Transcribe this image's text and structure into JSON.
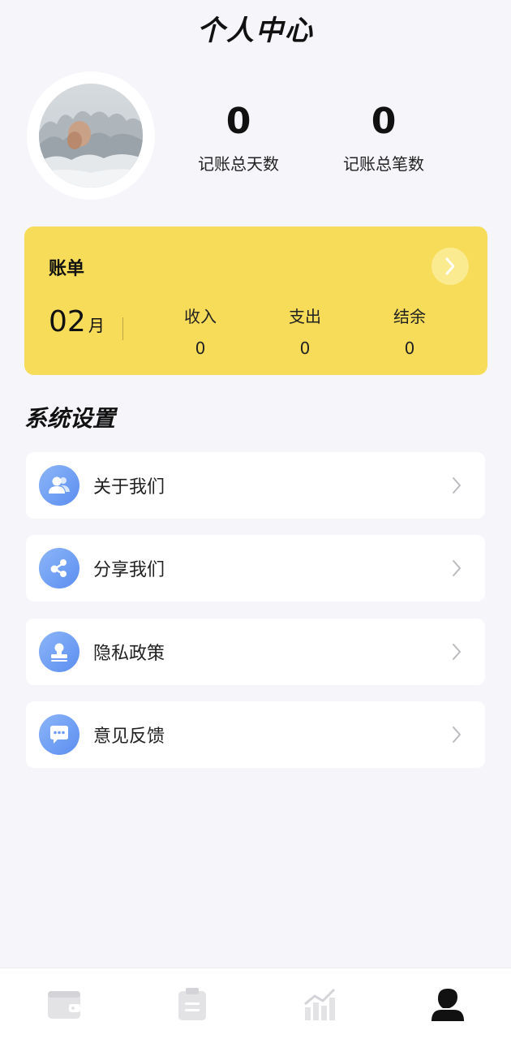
{
  "header": {
    "title": "个人中心"
  },
  "stats": {
    "days_value": "0",
    "days_label": "记账总天数",
    "count_value": "0",
    "count_label": "记账总笔数"
  },
  "bill": {
    "title": "账单",
    "arrow_icon": "chevron-right-icon",
    "month": "02",
    "month_unit": "月",
    "income_label": "收入",
    "income_value": "0",
    "expense_label": "支出",
    "expense_value": "0",
    "balance_label": "结余",
    "balance_value": "0"
  },
  "settings": {
    "title": "系统设置",
    "items": [
      {
        "label": "关于我们",
        "icon": "users-icon"
      },
      {
        "label": "分享我们",
        "icon": "share-icon"
      },
      {
        "label": "隐私政策",
        "icon": "stamp-icon"
      },
      {
        "label": "意见反馈",
        "icon": "chat-icon"
      }
    ]
  },
  "tabbar": {
    "tabs": [
      {
        "name": "wallet",
        "icon": "wallet-icon",
        "active": false
      },
      {
        "name": "bills",
        "icon": "clipboard-icon",
        "active": false
      },
      {
        "name": "chart",
        "icon": "chart-icon",
        "active": false
      },
      {
        "name": "profile",
        "icon": "user-icon",
        "active": true
      }
    ]
  },
  "colors": {
    "background": "#f5f5fa",
    "accent_yellow": "#f7dc5a",
    "icon_blue": "#6b9cf3",
    "tab_inactive": "#e3e3e6",
    "tab_active": "#111111"
  }
}
